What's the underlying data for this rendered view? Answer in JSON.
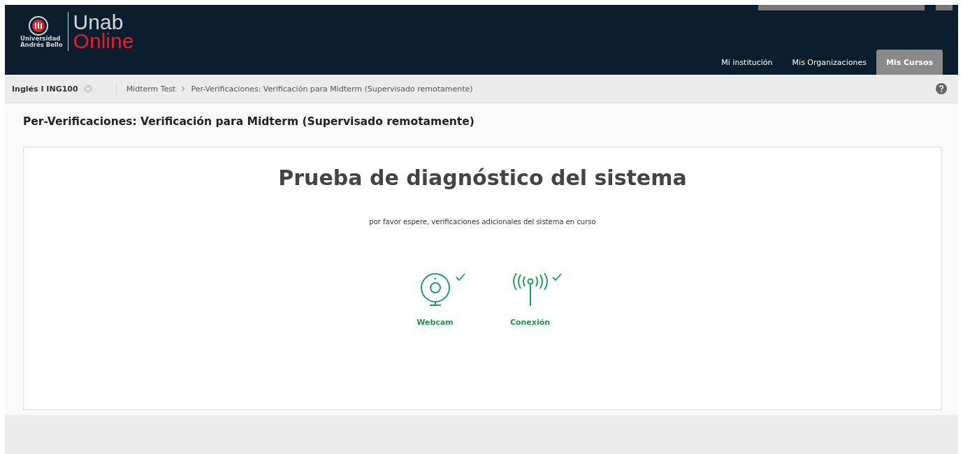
{
  "logo": {
    "university_line_1": "Universidad",
    "university_line_2": "Andrés Bello",
    "brand_top": "Unab",
    "brand_bottom": "Online"
  },
  "nav_tabs": [
    {
      "label": "Mi institución",
      "selected": false
    },
    {
      "label": "Mis Organizaciones",
      "selected": false
    },
    {
      "label": "Mis Cursos",
      "selected": true
    }
  ],
  "breadcrumb": {
    "course": "Inglés I ING100",
    "items": [
      "Midterm Test",
      "Per-Verificaciones: Verificación para Midterm (Supervisado remotamente)"
    ]
  },
  "page_title": "Per-Verificaciones: Verificación para Midterm (Supervisado remotamente)",
  "panel": {
    "heading": "Prueba de diagnóstico del sistema",
    "message": "por favor espere, verificaciones adicionales del sistema en curso",
    "checks": [
      {
        "kind": "webcam",
        "label": "Webcam",
        "checked": true
      },
      {
        "kind": "connection",
        "label": "Conexión",
        "checked": true
      }
    ]
  }
}
